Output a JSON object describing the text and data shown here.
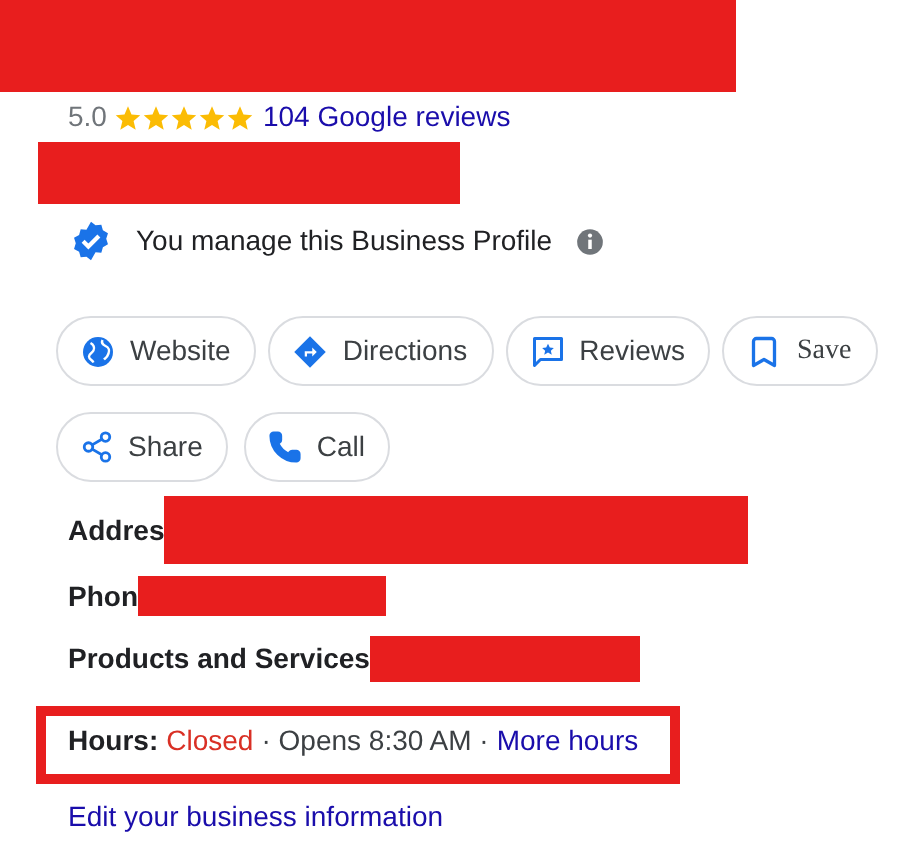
{
  "rating": {
    "score": "5.0",
    "stars": 5,
    "reviews_link": "104 Google reviews"
  },
  "managed_notice": "You manage this Business Profile",
  "actions": [
    {
      "kind": "website",
      "label": "Website"
    },
    {
      "kind": "directions",
      "label": "Directions"
    },
    {
      "kind": "reviews",
      "label": "Reviews"
    },
    {
      "kind": "save",
      "label": "Save"
    },
    {
      "kind": "share",
      "label": "Share"
    },
    {
      "kind": "call",
      "label": "Call"
    }
  ],
  "details": [
    {
      "label": "Addres"
    },
    {
      "label": "Phon"
    },
    {
      "label": "Products and Services"
    }
  ],
  "hours": {
    "label": "Hours:",
    "status": "Closed",
    "opens": "· Opens 8:30 AM ·",
    "more_link": "More hours"
  },
  "edit_link": "Edit your business information"
}
